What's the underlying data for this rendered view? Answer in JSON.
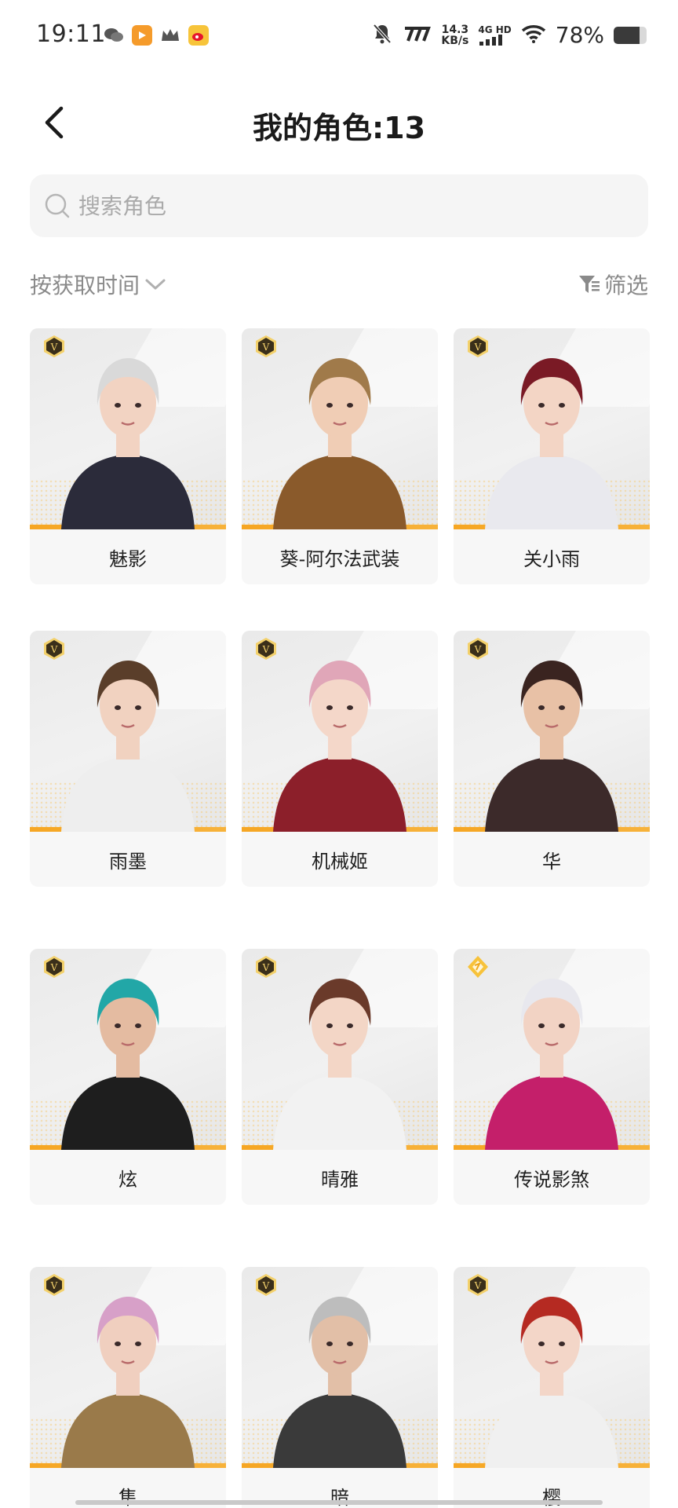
{
  "status_bar": {
    "time": "19:11",
    "net_speed_value": "14.3",
    "net_speed_unit": "KB/s",
    "network_type": "4G HD",
    "battery_percent": "78%",
    "battery_level": 0.78,
    "app_icons": [
      "wechat-icon",
      "video-app-icon",
      "crown-icon",
      "weibo-icon"
    ]
  },
  "header": {
    "title": "我的角色:13"
  },
  "search": {
    "placeholder": "搜索角色",
    "value": ""
  },
  "toolbar": {
    "sort_label": "按获取时间",
    "filter_label": "筛选"
  },
  "characters": [
    {
      "name": "魅影",
      "badge": "V",
      "badge_type": "v"
    },
    {
      "name": "葵-阿尔法武装",
      "badge": "V",
      "badge_type": "v"
    },
    {
      "name": "关小雨",
      "badge": "V",
      "badge_type": "v"
    },
    {
      "name": "雨墨",
      "badge": "V",
      "badge_type": "v"
    },
    {
      "name": "机械姬",
      "badge": "V",
      "badge_type": "v"
    },
    {
      "name": "华",
      "badge": "V",
      "badge_type": "v"
    },
    {
      "name": "炫",
      "badge": "V",
      "badge_type": "v"
    },
    {
      "name": "晴雅",
      "badge": "V",
      "badge_type": "v"
    },
    {
      "name": "传说影煞",
      "badge": "",
      "badge_type": "legend"
    },
    {
      "name": "隼",
      "badge": "V",
      "badge_type": "v"
    },
    {
      "name": "暗",
      "badge": "V",
      "badge_type": "v"
    },
    {
      "name": "樱",
      "badge": "V",
      "badge_type": "v"
    }
  ],
  "colors": {
    "accent": "#f6a623",
    "badge_gold": "#c9a13b",
    "card_bg": "#f7f7f7",
    "muted_text": "#8a8a8a"
  }
}
